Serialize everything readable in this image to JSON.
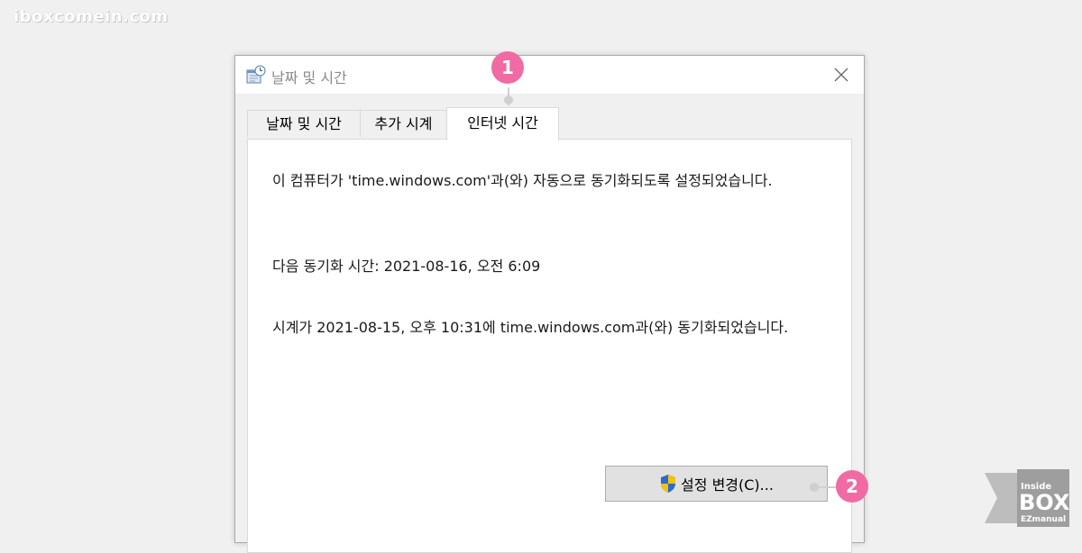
{
  "watermark": "iboxcomein.com",
  "dialog": {
    "title": "날짜 및 시간",
    "tabs": [
      {
        "label": "날짜 및 시간",
        "active": false
      },
      {
        "label": "추가 시계",
        "active": false
      },
      {
        "label": "인터넷 시간",
        "active": true
      }
    ],
    "content": {
      "sync_setting": "이 컴퓨터가 'time.windows.com'과(와) 자동으로 동기화되도록 설정되었습니다.",
      "next_sync": "다음 동기화 시간: 2021-08-16, 오전 6:09",
      "last_sync": "시계가 2021-08-15, 오후 10:31에 time.windows.com과(와) 동기화되었습니다."
    },
    "change_button": "설정 변경(C)..."
  },
  "annotations": {
    "badge_1": "1",
    "badge_2": "2"
  },
  "logo": {
    "line1": "Inside",
    "line2": "BOX",
    "line3": "EZmanual"
  },
  "colors": {
    "badge": "#f06ba3",
    "window_bg": "#f0f0f0",
    "panel_bg": "#ffffff",
    "button_bg": "#e1e1e1"
  },
  "icons": {
    "title": "date-time-icon",
    "close": "close-icon",
    "button": "uac-shield-icon"
  }
}
